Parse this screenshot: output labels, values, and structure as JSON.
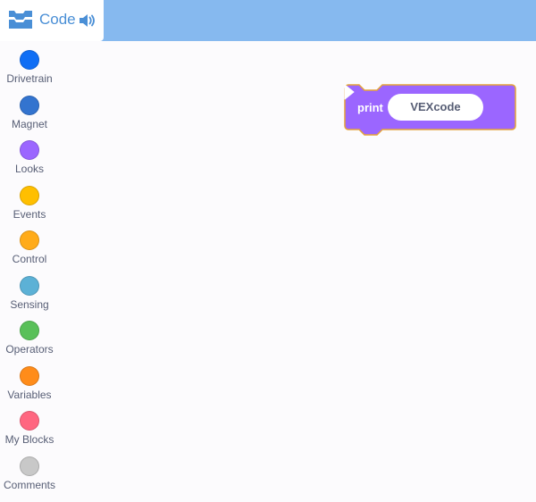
{
  "header": {
    "tab_label": "Code",
    "tab_icon": "blocks-icon",
    "sound_icon": "speaker-icon",
    "colors": {
      "bar": "#86b9ef",
      "tab": "#ffffff",
      "accent": "#4a8fd6"
    }
  },
  "sidebar": {
    "categories": [
      {
        "label": "Drivetrain",
        "color": "#0f6ef5"
      },
      {
        "label": "Magnet",
        "color": "#3374cf"
      },
      {
        "label": "Looks",
        "color": "#9b66ff"
      },
      {
        "label": "Events",
        "color": "#ffbf00"
      },
      {
        "label": "Control",
        "color": "#ffab19"
      },
      {
        "label": "Sensing",
        "color": "#5cb1d6"
      },
      {
        "label": "Operators",
        "color": "#59c059"
      },
      {
        "label": "Variables",
        "color": "#ff8c1a"
      },
      {
        "label": "My Blocks",
        "color": "#ff6680"
      },
      {
        "label": "Comments",
        "color": "#c8c8c8"
      }
    ]
  },
  "workspace": {
    "block": {
      "keyword": "print",
      "value": "VEXcode",
      "color": "#9b66ff",
      "outline": "#e4a23a",
      "arrow_icon": "play-arrow-icon"
    }
  }
}
